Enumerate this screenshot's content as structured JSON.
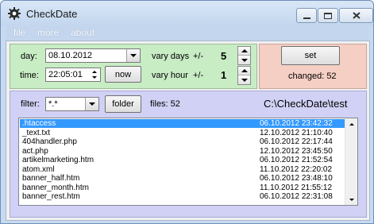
{
  "window": {
    "title": "CheckDate"
  },
  "menu": [
    "file",
    "more",
    "about"
  ],
  "dates": {
    "day_label": "day:",
    "day_value": "08.10.2012",
    "time_label": "time:",
    "time_value": "22:05:01",
    "now_label": "now",
    "vary_days_label": "vary days",
    "vary_days_pm": "+/-",
    "vary_days_value": "5",
    "vary_hour_label": "vary hour",
    "vary_hour_pm": "+/-",
    "vary_hour_value": "1"
  },
  "action": {
    "set_label": "set",
    "changed_text": "changed: 52"
  },
  "files": {
    "filter_label": "filter:",
    "filter_value": "*.*",
    "folder_label": "folder",
    "count_text": "files: 52",
    "path": "C:\\CheckDate\\test",
    "rows": [
      {
        "name": ".htaccess",
        "date": "06.10.2012 23:42:32",
        "selected": true
      },
      {
        "name": "_text.txt",
        "date": "12.10.2012 21:10:40"
      },
      {
        "name": "404handler.php",
        "date": "06.10.2012 22:17:44"
      },
      {
        "name": "act.php",
        "date": "12.10.2012 23:45:50"
      },
      {
        "name": "artikelmarketing.htm",
        "date": "06.10.2012 21:52:54"
      },
      {
        "name": "atom.xml",
        "date": "11.10.2012 22:20:02"
      },
      {
        "name": "banner_half.htm",
        "date": "06.10.2012 23:48:10"
      },
      {
        "name": "banner_month.htm",
        "date": "11.10.2012 21:55:12"
      },
      {
        "name": "banner_rest.htm",
        "date": "06.10.2012 22:31:08"
      }
    ]
  },
  "colors": {
    "dates_panel": "#c8ecc4",
    "action_panel": "#f6cfc4",
    "files_panel": "#d1d1f5",
    "selection": "#3399ff"
  }
}
